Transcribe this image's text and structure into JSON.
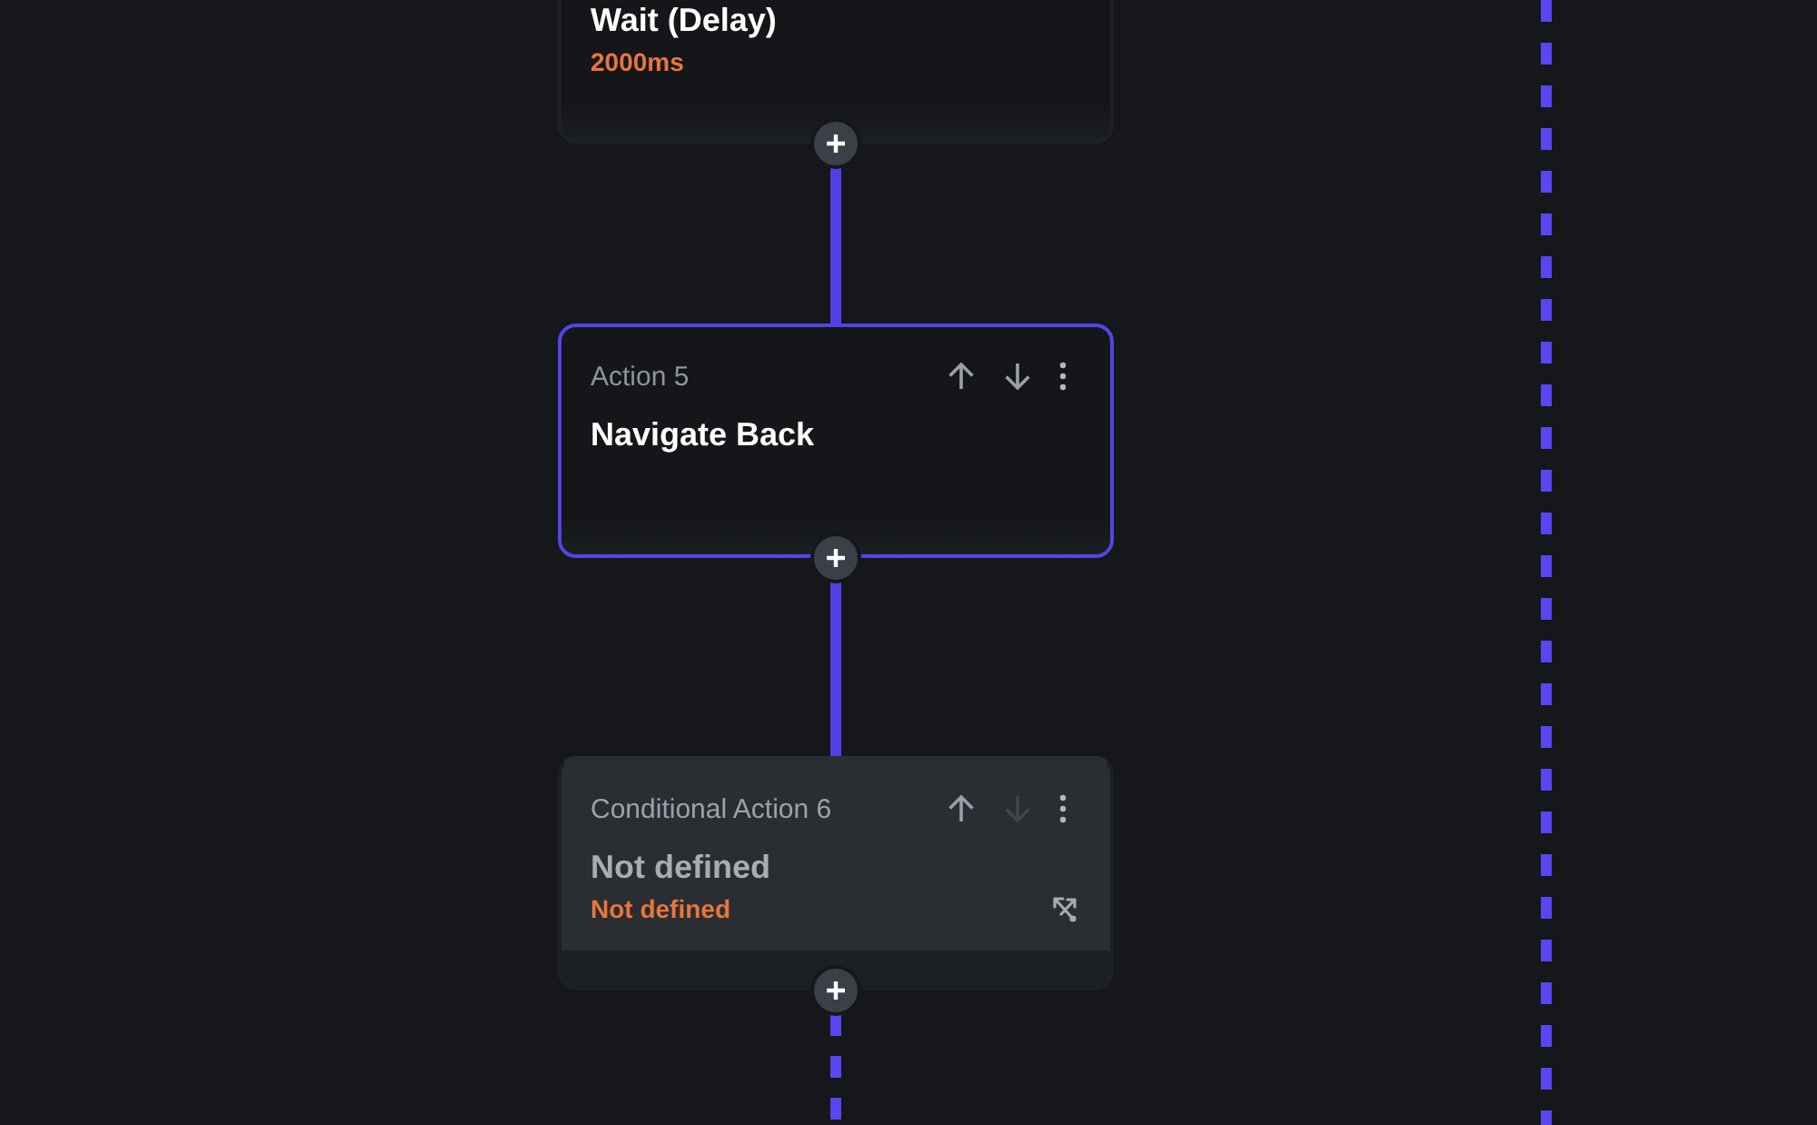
{
  "canvas": {
    "steps": [
      {
        "kind": "action",
        "selected": false,
        "title": "Wait (Delay)",
        "detail": "2000ms"
      },
      {
        "kind": "action",
        "selected": true,
        "label": "Action 5",
        "title": "Navigate Back",
        "up_disabled": false,
        "down_disabled": false
      },
      {
        "kind": "conditional",
        "selected": false,
        "label": "Conditional Action 6",
        "title": "Not defined",
        "detail": "Not defined",
        "up_disabled": false,
        "down_disabled": true
      }
    ]
  }
}
